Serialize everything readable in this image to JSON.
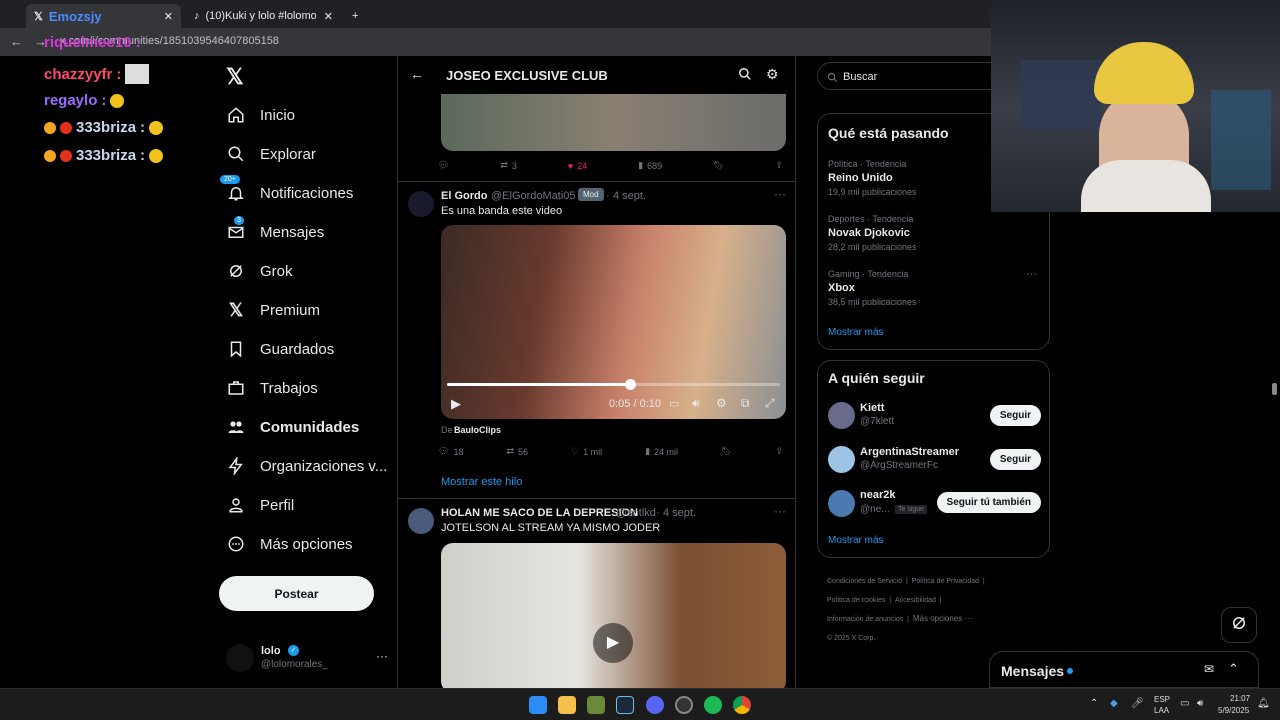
{
  "browser": {
    "tabs": [
      {
        "title": "Emozsjy"
      },
      {
        "title": "(10)Kuki y lolo #lolomorales #"
      }
    ],
    "url": "x.com/i/communities/1851039546407805158"
  },
  "chat": [
    {
      "user": "riquelmee10",
      "color": "#d33ad3"
    },
    {
      "user": "chazzyyfr",
      "color": "#ff4a6a"
    },
    {
      "user": "regaylo",
      "color": "#9b6cff"
    },
    {
      "user": "333briza",
      "color": "#c8d7f0"
    },
    {
      "user": "333briza",
      "color": "#c8d7f0"
    }
  ],
  "sidebar": {
    "items": [
      {
        "label": "Inicio",
        "icon": "home-icon"
      },
      {
        "label": "Explorar",
        "icon": "search-icon"
      },
      {
        "label": "Notificaciones",
        "icon": "bell-icon",
        "badge": "20+"
      },
      {
        "label": "Mensajes",
        "icon": "mail-icon",
        "badge": "3"
      },
      {
        "label": "Grok",
        "icon": "grok-icon"
      },
      {
        "label": "Premium",
        "icon": "x-logo-icon"
      },
      {
        "label": "Guardados",
        "icon": "bookmark-icon"
      },
      {
        "label": "Trabajos",
        "icon": "briefcase-icon"
      },
      {
        "label": "Comunidades",
        "icon": "people-icon"
      },
      {
        "label": "Organizaciones v...",
        "icon": "lightning-icon"
      },
      {
        "label": "Perfil",
        "icon": "person-icon"
      },
      {
        "label": "Más opciones",
        "icon": "more-circle-icon"
      }
    ],
    "post_button": "Postear",
    "account": {
      "name": "lolo",
      "handle": "@lolomorales_"
    }
  },
  "feed": {
    "header": "JOSEO EXCLUSIVE CLUB",
    "post0_actions": {
      "retweets": "3",
      "likes": "24",
      "views": "689"
    },
    "post1": {
      "author": "El Gordo",
      "handle": "@ElGordoMati05",
      "badge": "Mod",
      "date": "4 sept.",
      "text": "Es una banda este video",
      "video_time": "0:05 / 0:10",
      "video_progress": 0.55,
      "source_prefix": "De",
      "source": "BauloClips",
      "replies": "18",
      "retweets": "56",
      "likes": "1 mil",
      "views": "24 mil"
    },
    "show_thread": "Mostrar este hilo",
    "post2": {
      "author": "HOLAN ME SACO DE LA DEPRESION",
      "handle": "@sntlkd",
      "date": "4 sept.",
      "text": "JOTELSON AL STREAM YA MISMO JODER"
    }
  },
  "right": {
    "search_placeholder": "Buscar",
    "trends_title": "Qué está pasando",
    "trends": [
      {
        "category": "Política · Tendencia",
        "name": "Reino Unido",
        "count": "19,9 mil publicaciones"
      },
      {
        "category": "Deportes · Tendencia",
        "name": "Novak Djokovic",
        "count": "28,2 mil publicaciones"
      },
      {
        "category": "Gaming · Tendencia",
        "name": "Xbox",
        "count": "38,5 mil publicaciones"
      }
    ],
    "show_more": "Mostrar más",
    "follow_title": "A quién seguir",
    "follow": [
      {
        "name": "Kiett",
        "handle": "@7kiett",
        "button": "Seguir"
      },
      {
        "name": "ArgentinaStreamer",
        "handle": "@ArgStreamerFc",
        "button": "Seguir"
      },
      {
        "name": "near2k",
        "handle": "@ne...",
        "follows_you": "Te sigue",
        "button": "Seguir tú también"
      }
    ],
    "show_more2": "Mostrar más",
    "footer": [
      "Condiciones de Servicio",
      "Política de Privacidad",
      "Política de cookies",
      "Accesibilidad",
      "Información de anuncios",
      "Más opciones ···",
      "© 2025 X Corp."
    ]
  },
  "messages_drawer": "Mensajes",
  "taskbar": {
    "lang1": "ESP",
    "lang2": "LAA",
    "time": "21:07",
    "date": "5/9/2025"
  }
}
